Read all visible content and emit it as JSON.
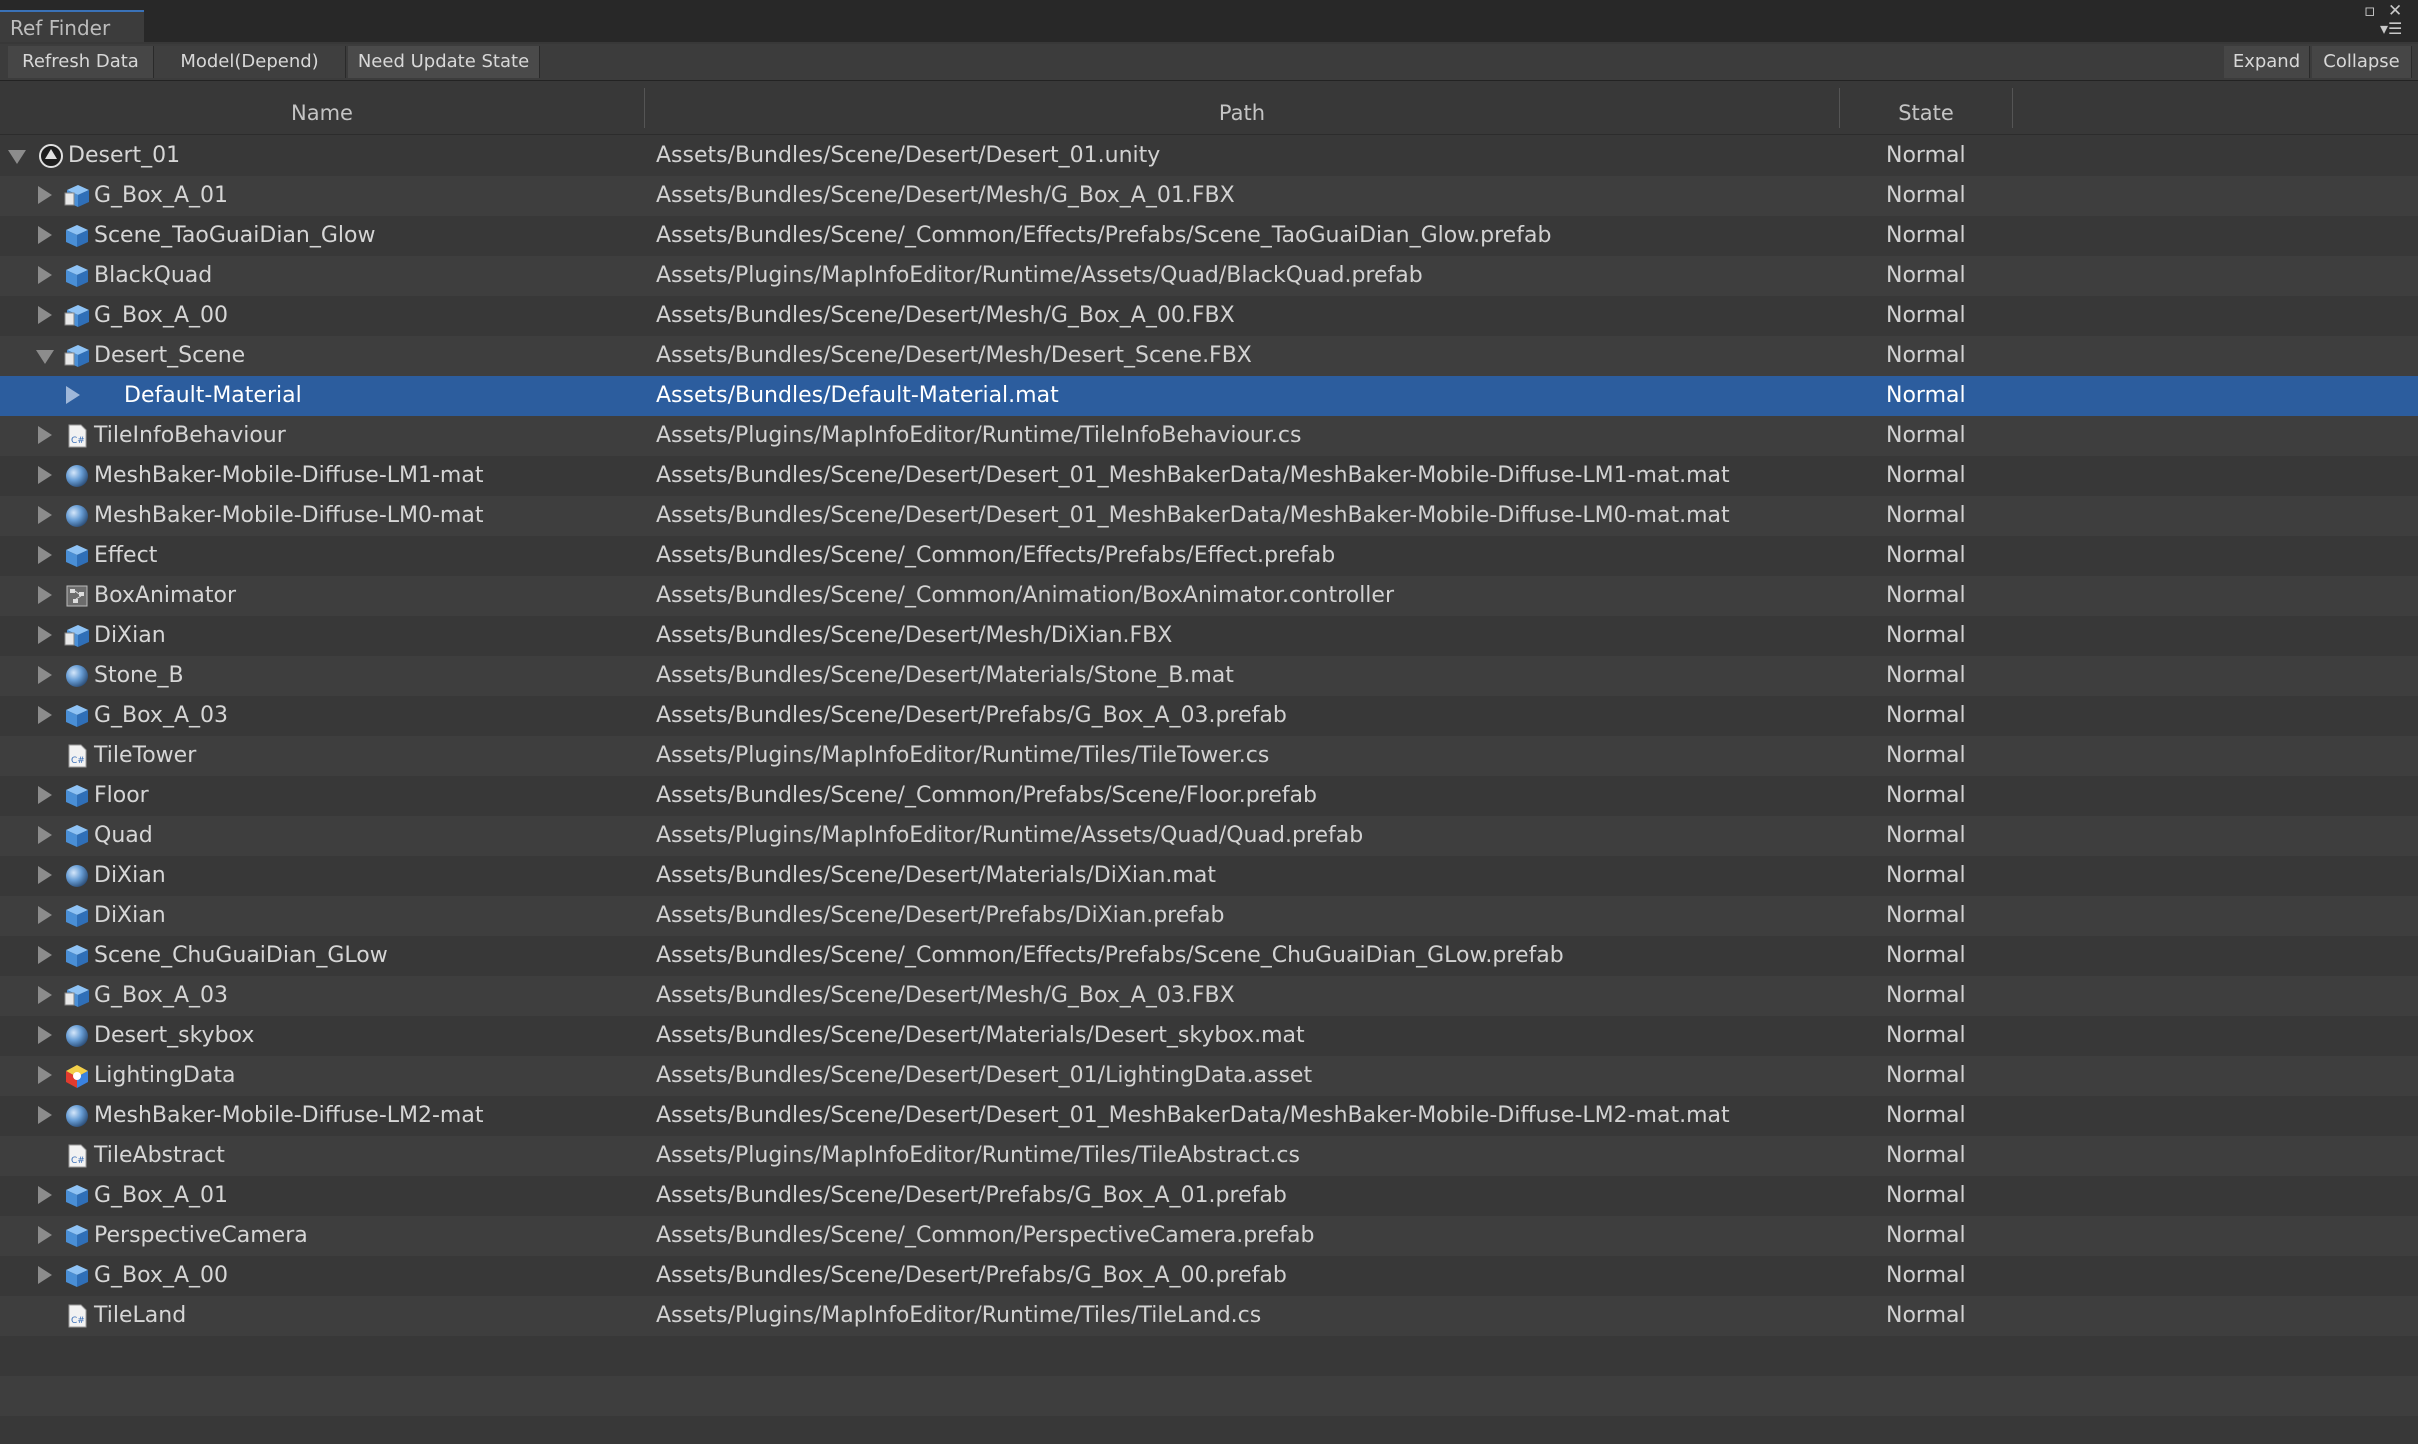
{
  "window": {
    "tab_title": "Ref Finder"
  },
  "toolbar": {
    "refresh": "Refresh Data",
    "mode": "Model(Depend)",
    "need_update": "Need Update State",
    "expand": "Expand",
    "collapse": "Collapse"
  },
  "columns": {
    "name": "Name",
    "path": "Path",
    "state": "State"
  },
  "accent_colors": {
    "selection": "#2c5d9e",
    "tab_highlight": "#3a72b8"
  },
  "rows": [
    {
      "name": "Desert_01",
      "path": "Assets/Bundles/Scene/Desert/Desert_01.unity",
      "state": "Normal",
      "icon": "unity-scene-icon",
      "depth": 0,
      "arrow": "open"
    },
    {
      "name": "G_Box_A_01",
      "path": "Assets/Bundles/Scene/Desert/Mesh/G_Box_A_01.FBX",
      "state": "Normal",
      "icon": "model-icon",
      "depth": 1,
      "arrow": "closed"
    },
    {
      "name": "Scene_TaoGuaiDian_Glow",
      "path": "Assets/Bundles/Scene/_Common/Effects/Prefabs/Scene_TaoGuaiDian_Glow.prefab",
      "state": "Normal",
      "icon": "prefab-icon",
      "depth": 1,
      "arrow": "closed"
    },
    {
      "name": "BlackQuad",
      "path": "Assets/Plugins/MapInfoEditor/Runtime/Assets/Quad/BlackQuad.prefab",
      "state": "Normal",
      "icon": "prefab-icon",
      "depth": 1,
      "arrow": "closed"
    },
    {
      "name": "G_Box_A_00",
      "path": "Assets/Bundles/Scene/Desert/Mesh/G_Box_A_00.FBX",
      "state": "Normal",
      "icon": "model-icon",
      "depth": 1,
      "arrow": "closed"
    },
    {
      "name": "Desert_Scene",
      "path": "Assets/Bundles/Scene/Desert/Mesh/Desert_Scene.FBX",
      "state": "Normal",
      "icon": "model-icon",
      "depth": 1,
      "arrow": "open"
    },
    {
      "name": "Default-Material",
      "path": "Assets/Bundles/Default-Material.mat",
      "state": "Normal",
      "icon": "none",
      "depth": 2,
      "arrow": "closed",
      "selected": true
    },
    {
      "name": "TileInfoBehaviour",
      "path": "Assets/Plugins/MapInfoEditor/Runtime/TileInfoBehaviour.cs",
      "state": "Normal",
      "icon": "csharp-script-icon",
      "depth": 1,
      "arrow": "closed"
    },
    {
      "name": "MeshBaker-Mobile-Diffuse-LM1-mat",
      "path": "Assets/Bundles/Scene/Desert/Desert_01_MeshBakerData/MeshBaker-Mobile-Diffuse-LM1-mat.mat",
      "state": "Normal",
      "icon": "material-icon",
      "depth": 1,
      "arrow": "closed"
    },
    {
      "name": "MeshBaker-Mobile-Diffuse-LM0-mat",
      "path": "Assets/Bundles/Scene/Desert/Desert_01_MeshBakerData/MeshBaker-Mobile-Diffuse-LM0-mat.mat",
      "state": "Normal",
      "icon": "material-icon",
      "depth": 1,
      "arrow": "closed"
    },
    {
      "name": "Effect",
      "path": "Assets/Bundles/Scene/_Common/Effects/Prefabs/Effect.prefab",
      "state": "Normal",
      "icon": "prefab-icon",
      "depth": 1,
      "arrow": "closed"
    },
    {
      "name": "BoxAnimator",
      "path": "Assets/Bundles/Scene/_Common/Animation/BoxAnimator.controller",
      "state": "Normal",
      "icon": "animator-controller-icon",
      "depth": 1,
      "arrow": "closed"
    },
    {
      "name": "DiXian",
      "path": "Assets/Bundles/Scene/Desert/Mesh/DiXian.FBX",
      "state": "Normal",
      "icon": "model-icon",
      "depth": 1,
      "arrow": "closed"
    },
    {
      "name": "Stone_B",
      "path": "Assets/Bundles/Scene/Desert/Materials/Stone_B.mat",
      "state": "Normal",
      "icon": "material-icon",
      "depth": 1,
      "arrow": "closed"
    },
    {
      "name": "G_Box_A_03",
      "path": "Assets/Bundles/Scene/Desert/Prefabs/G_Box_A_03.prefab",
      "state": "Normal",
      "icon": "prefab-icon",
      "depth": 1,
      "arrow": "closed"
    },
    {
      "name": "TileTower",
      "path": "Assets/Plugins/MapInfoEditor/Runtime/Tiles/TileTower.cs",
      "state": "Normal",
      "icon": "csharp-script-icon",
      "depth": 1,
      "arrow": "none"
    },
    {
      "name": "Floor",
      "path": "Assets/Bundles/Scene/_Common/Prefabs/Scene/Floor.prefab",
      "state": "Normal",
      "icon": "prefab-icon",
      "depth": 1,
      "arrow": "closed"
    },
    {
      "name": "Quad",
      "path": "Assets/Plugins/MapInfoEditor/Runtime/Assets/Quad/Quad.prefab",
      "state": "Normal",
      "icon": "prefab-icon",
      "depth": 1,
      "arrow": "closed"
    },
    {
      "name": "DiXian",
      "path": "Assets/Bundles/Scene/Desert/Materials/DiXian.mat",
      "state": "Normal",
      "icon": "material-icon",
      "depth": 1,
      "arrow": "closed"
    },
    {
      "name": "DiXian",
      "path": "Assets/Bundles/Scene/Desert/Prefabs/DiXian.prefab",
      "state": "Normal",
      "icon": "prefab-icon",
      "depth": 1,
      "arrow": "closed"
    },
    {
      "name": "Scene_ChuGuaiDian_GLow",
      "path": "Assets/Bundles/Scene/_Common/Effects/Prefabs/Scene_ChuGuaiDian_GLow.prefab",
      "state": "Normal",
      "icon": "prefab-icon",
      "depth": 1,
      "arrow": "closed"
    },
    {
      "name": "G_Box_A_03",
      "path": "Assets/Bundles/Scene/Desert/Mesh/G_Box_A_03.FBX",
      "state": "Normal",
      "icon": "model-icon",
      "depth": 1,
      "arrow": "closed"
    },
    {
      "name": "Desert_skybox",
      "path": "Assets/Bundles/Scene/Desert/Materials/Desert_skybox.mat",
      "state": "Normal",
      "icon": "material-icon",
      "depth": 1,
      "arrow": "closed"
    },
    {
      "name": "LightingData",
      "path": "Assets/Bundles/Scene/Desert/Desert_01/LightingData.asset",
      "state": "Normal",
      "icon": "lighting-data-icon",
      "depth": 1,
      "arrow": "closed"
    },
    {
      "name": "MeshBaker-Mobile-Diffuse-LM2-mat",
      "path": "Assets/Bundles/Scene/Desert/Desert_01_MeshBakerData/MeshBaker-Mobile-Diffuse-LM2-mat.mat",
      "state": "Normal",
      "icon": "material-icon",
      "depth": 1,
      "arrow": "closed"
    },
    {
      "name": "TileAbstract",
      "path": "Assets/Plugins/MapInfoEditor/Runtime/Tiles/TileAbstract.cs",
      "state": "Normal",
      "icon": "csharp-script-icon",
      "depth": 1,
      "arrow": "none"
    },
    {
      "name": "G_Box_A_01",
      "path": "Assets/Bundles/Scene/Desert/Prefabs/G_Box_A_01.prefab",
      "state": "Normal",
      "icon": "prefab-icon",
      "depth": 1,
      "arrow": "closed"
    },
    {
      "name": "PerspectiveCamera",
      "path": "Assets/Bundles/Scene/_Common/PerspectiveCamera.prefab",
      "state": "Normal",
      "icon": "prefab-icon",
      "depth": 1,
      "arrow": "closed"
    },
    {
      "name": "G_Box_A_00",
      "path": "Assets/Bundles/Scene/Desert/Prefabs/G_Box_A_00.prefab",
      "state": "Normal",
      "icon": "prefab-icon",
      "depth": 1,
      "arrow": "closed"
    },
    {
      "name": "TileLand",
      "path": "Assets/Plugins/MapInfoEditor/Runtime/Tiles/TileLand.cs",
      "state": "Normal",
      "icon": "csharp-script-icon",
      "depth": 1,
      "arrow": "none"
    }
  ]
}
